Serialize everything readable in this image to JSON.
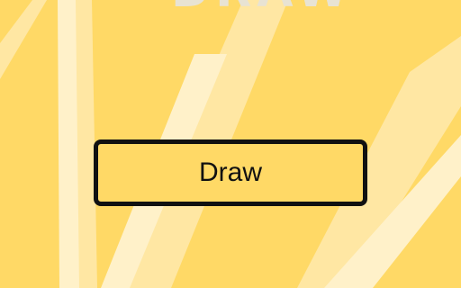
{
  "screen": {
    "title": "DRAW"
  },
  "button": {
    "label": "Draw"
  },
  "colors": {
    "background": "#FFD966",
    "ray_light": "#FFE7A3",
    "ray_lighter": "#FFF1C9",
    "button_border": "#111111",
    "title_text": "#E8E3D3"
  }
}
